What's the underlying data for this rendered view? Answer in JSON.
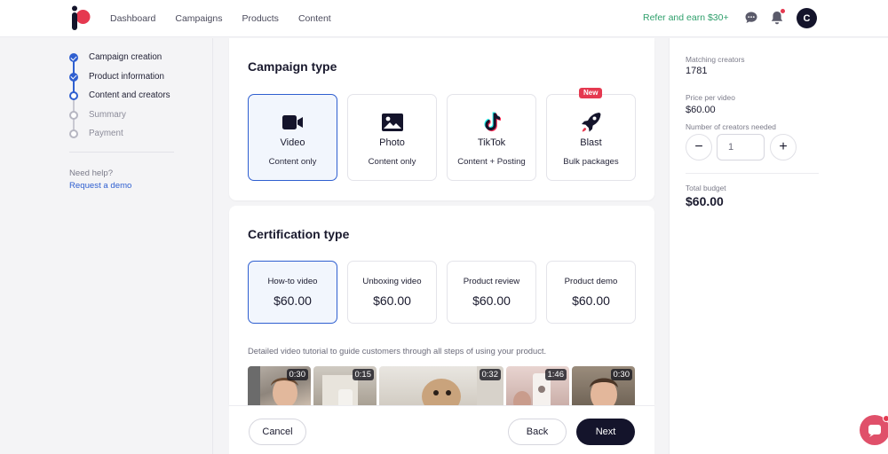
{
  "nav": {
    "items": [
      "Dashboard",
      "Campaigns",
      "Products",
      "Content"
    ],
    "refer": "Refer and earn $30+",
    "avatar_initial": "C"
  },
  "steps": [
    {
      "label": "Campaign creation",
      "state": "done"
    },
    {
      "label": "Product information",
      "state": "done"
    },
    {
      "label": "Content and creators",
      "state": "current"
    },
    {
      "label": "Summary",
      "state": "todo"
    },
    {
      "label": "Payment",
      "state": "todo"
    }
  ],
  "help": {
    "text": "Need help?",
    "link": "Request a demo"
  },
  "campaign_type": {
    "title": "Campaign type",
    "new_badge": "New",
    "options": [
      {
        "name": "Video",
        "sub": "Content only",
        "icon": "video-camera-icon",
        "selected": true
      },
      {
        "name": "Photo",
        "sub": "Content only",
        "icon": "image-icon",
        "selected": false
      },
      {
        "name": "TikTok",
        "sub": "Content + Posting",
        "icon": "tiktok-icon",
        "selected": false
      },
      {
        "name": "Blast",
        "sub": "Bulk packages",
        "icon": "rocket-icon",
        "selected": false
      }
    ]
  },
  "certification": {
    "title": "Certification type",
    "options": [
      {
        "name": "How-to video",
        "price": "$60.00",
        "selected": true
      },
      {
        "name": "Unboxing video",
        "price": "$60.00",
        "selected": false
      },
      {
        "name": "Product review",
        "price": "$60.00",
        "selected": false
      },
      {
        "name": "Product demo",
        "price": "$60.00",
        "selected": false
      }
    ],
    "description": "Detailed video tutorial to guide customers through all steps of using your product.",
    "videos": [
      "0:30",
      "0:15",
      "0:32",
      "1:46",
      "0:30"
    ]
  },
  "footer": {
    "cancel": "Cancel",
    "back": "Back",
    "next": "Next"
  },
  "summary": {
    "matching_label": "Matching creators",
    "matching_value": "1781",
    "price_label": "Price per video",
    "price_value": "$60.00",
    "count_label": "Number of creators needed",
    "count_value": "1",
    "minus": "−",
    "plus": "+",
    "total_label": "Total budget",
    "total_value": "$60.00"
  },
  "colors": {
    "accent": "#2f5fd0",
    "dark": "#14142b",
    "refer": "#2e9f6b",
    "alert": "#e53950"
  }
}
